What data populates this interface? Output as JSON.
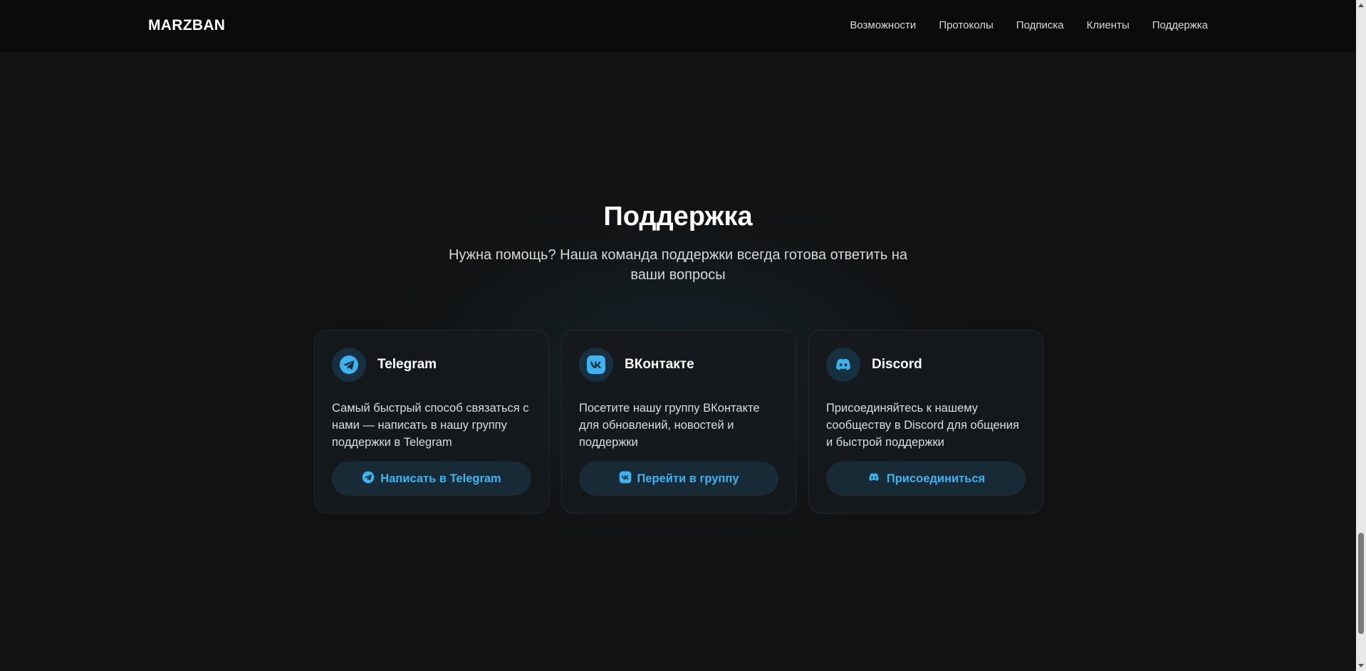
{
  "header": {
    "logo": "MARZBAN",
    "nav": [
      "Возможности",
      "Протоколы",
      "Подписка",
      "Клиенты",
      "Поддержка"
    ]
  },
  "support": {
    "title": "Поддержка",
    "subtitle": "Нужна помощь? Наша команда поддержки всегда готова ответить на ваши вопросы",
    "cards": [
      {
        "icon": "telegram-icon",
        "title": "Telegram",
        "description": "Самый быстрый способ связаться с нами — написать в нашу группу поддержки в Telegram",
        "button": "Написать в Telegram"
      },
      {
        "icon": "vk-icon",
        "title": "ВКонтакте",
        "description": "Посетите нашу группу ВКонтакте для обновлений, новостей и поддержки",
        "button": "Перейти в группу"
      },
      {
        "icon": "discord-icon",
        "title": "Discord",
        "description": "Присоединяйтесь к нашему сообществу в Discord для общения и быстрой поддержки",
        "button": "Присоединиться"
      }
    ]
  },
  "colors": {
    "accent": "#3fb3f0",
    "background": "#121212",
    "header": "#0b0b0b",
    "card": "#16191c",
    "button": "#172a35"
  }
}
